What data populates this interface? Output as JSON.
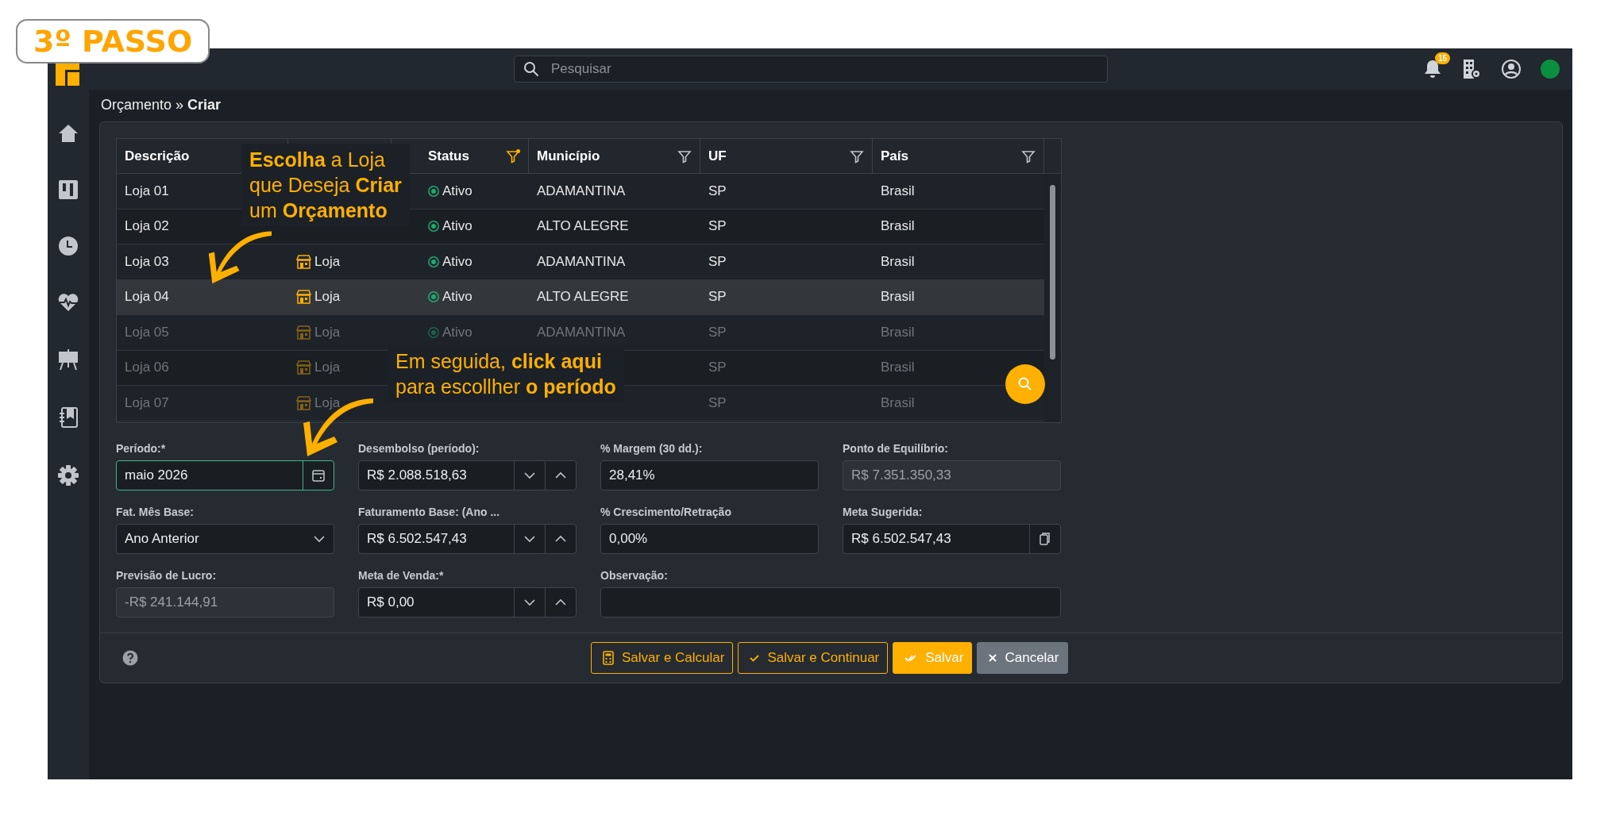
{
  "step_badge": "3º PASSO",
  "topbar": {
    "search": {
      "placeholder": "Pesquisar"
    },
    "notifications": "15",
    "online": true
  },
  "breadcrumb": {
    "parent": "Orçamento",
    "separator": "»",
    "current": "Criar"
  },
  "table": {
    "columns": [
      {
        "kind": "header",
        "label": "Descrição"
      },
      {
        "kind": "covered"
      },
      {
        "kind": "header",
        "label": "Status",
        "filter_active": true
      },
      {
        "kind": "header",
        "label": "Município",
        "filter_active": false
      },
      {
        "kind": "header",
        "label": "UF",
        "filter_active": false
      },
      {
        "kind": "header",
        "label": "País",
        "filter_active": false
      }
    ],
    "rows": [
      {
        "description": "Loja 01",
        "status": "Ativo",
        "municipio": "ADAMANTINA",
        "uf": "SP",
        "pais": "Brasil",
        "selected": false,
        "dimmed": false
      },
      {
        "description": "Loja 02",
        "status": "Ativo",
        "municipio": "ALTO ALEGRE",
        "uf": "SP",
        "pais": "Brasil",
        "selected": false,
        "dimmed": false
      },
      {
        "description": "Loja 03",
        "type": "Loja",
        "status": "Ativo",
        "municipio": "ADAMANTINA",
        "uf": "SP",
        "pais": "Brasil",
        "selected": false,
        "dimmed": false
      },
      {
        "description": "Loja 04",
        "type": "Loja",
        "status": "Ativo",
        "municipio": "ALTO ALEGRE",
        "uf": "SP",
        "pais": "Brasil",
        "selected": true,
        "dimmed": false
      },
      {
        "description": "Loja 05",
        "type": "Loja",
        "status": "Ativo",
        "municipio": "ADAMANTINA",
        "uf": "SP",
        "pais": "Brasil",
        "selected": false,
        "dimmed": true
      },
      {
        "description": "Loja 06",
        "type": "Loja",
        "uf": "SP",
        "pais": "Brasil",
        "selected": false,
        "dimmed": true
      },
      {
        "description": "Loja 07",
        "type": "Loja",
        "uf": "SP",
        "pais": "Brasil",
        "selected": false,
        "dimmed": true
      }
    ]
  },
  "form": {
    "fields": [
      {
        "label": "Período:*",
        "kind": "date",
        "value": "maio 2026",
        "focused": true
      },
      {
        "label": "Desembolso (período):",
        "kind": "spinner",
        "value": "R$ 2.088.518,63",
        "focused": false
      },
      {
        "label": "% Margem (30 dd.):",
        "kind": "text",
        "value": "28,41%",
        "focused": false
      },
      {
        "label": "Ponto de Equilíbrio:",
        "kind": "readonly",
        "value": "R$ 7.351.350,33",
        "focused": false
      },
      {
        "label": "Fat. Mês Base:",
        "kind": "select",
        "value": "Ano Anterior",
        "focused": false
      },
      {
        "label": "Faturamento Base: (Ano ...",
        "kind": "spinner",
        "value": "R$ 6.502.547,43",
        "focused": false
      },
      {
        "label": "% Crescimento/Retração",
        "kind": "text",
        "value": "0,00%",
        "focused": false
      },
      {
        "label": "Meta Sugerida:",
        "kind": "copy",
        "value": "R$ 6.502.547,43",
        "focused": false
      },
      {
        "label": "Previsão de Lucro:",
        "kind": "readonly",
        "value": "-R$ 241.144,91",
        "focused": false
      },
      {
        "label": "Meta de Venda:*",
        "kind": "spinner",
        "value": "R$ 0,00",
        "focused": false
      },
      {
        "label": "Observação:",
        "kind": "wide",
        "focused": false
      }
    ]
  },
  "buttons": [
    {
      "kind": "calculate",
      "label": "Salvar e Calcular"
    },
    {
      "kind": "continue",
      "label": "Salvar e Continuar"
    },
    {
      "kind": "save",
      "label": "Salvar"
    },
    {
      "kind": "cancel",
      "label": "Cancelar"
    }
  ],
  "callouts": [
    {
      "lines": [
        "**Escolha** a Loja",
        "que Deseja **Criar**",
        "um **Orçamento**"
      ]
    },
    {
      "lines": [
        "Em seguida, **click aqui**",
        "para escollher **o período**"
      ]
    }
  ]
}
